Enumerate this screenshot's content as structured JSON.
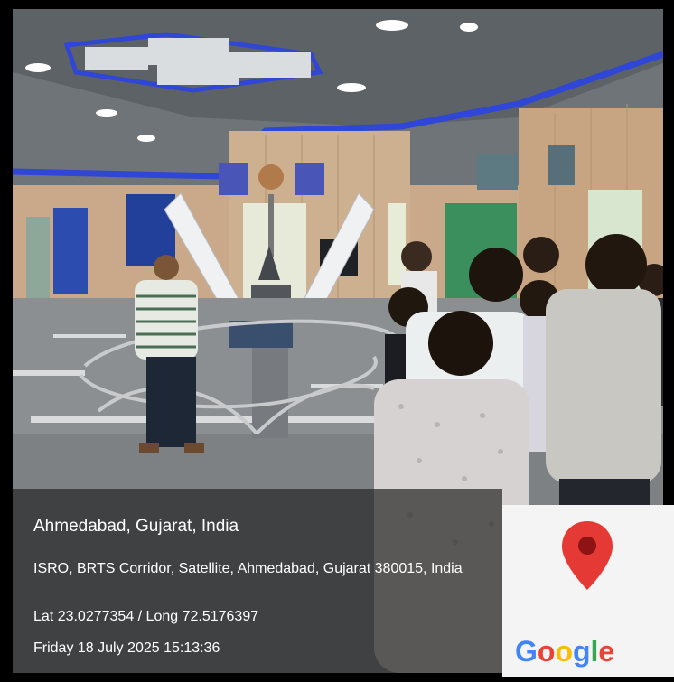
{
  "geotag": {
    "location_title": "Ahmedabad, Gujarat, India",
    "address": "ISRO, BRTS Corridor, Satellite, Ahmedabad, Gujarat 380015, India",
    "coordinates": "Lat 23.0277354 / Long 72.5176397",
    "datetime": "Friday 18 July 2025 15:13:36"
  },
  "google_logo": {
    "letters": [
      "G",
      "o",
      "o",
      "g",
      "l",
      "e"
    ],
    "colors": [
      "#4285F4",
      "#EA4335",
      "#FBBC05",
      "#4285F4",
      "#34A853",
      "#EA4335"
    ]
  },
  "pin_icon": "map-pin-icon",
  "colors": {
    "pin_red": "#E53935",
    "overlay": "#282828"
  }
}
